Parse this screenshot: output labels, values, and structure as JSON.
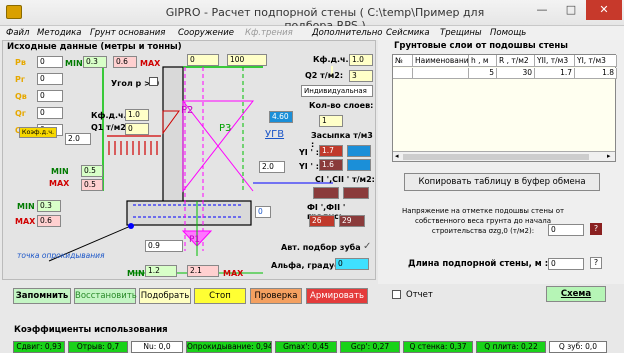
{
  "window": {
    "title": "GIPRO - Расчет подпорной стены ( C:\\temp\\Пример для подбора.RPS )",
    "minimize": "—",
    "maximize": "□",
    "close": "✕"
  },
  "menu": [
    "Файл",
    "Методика",
    "Грунт основания",
    "Сооружение",
    "Кф.трения",
    "Дополнительно",
    "Сейсмика",
    "Трещины",
    "Помощь"
  ],
  "input_header": "Исходные данные (метры и тонны)",
  "left": {
    "labels": {
      "pv": "Рв",
      "pg": "Рг",
      "qv": "Qв",
      "qg": "Qг",
      "qn": "Qп",
      "min": "MIN",
      "max": "MAX",
      "angle": "Угол р > 0",
      "kfdch": "Кф.д.ч.",
      "q1": "Q1 т/м2:",
      "koef": "Коэф.д.ч.",
      "min2": "MIN",
      "max2": "MAX",
      "min3": "MIN",
      "max3": "MAX",
      "min4": "MIN",
      "max4": "MAX",
      "point": "точка опрокидывания",
      "p1": "Р1",
      "p2": "Р2",
      "p3": "Р3",
      "ugv": "УГВ"
    },
    "values": {
      "pv": "0",
      "pg": "0",
      "qv": "0",
      "qg": "0",
      "qn": "0",
      "min1": "0.3",
      "max1": "0.6",
      "top1": "0",
      "top2": "100",
      "kfdch": "1.0",
      "q1": "0",
      "koef": "2.0",
      "v_05a": "0.5",
      "v_05b": "0.5",
      "min3": "0.3",
      "max3": "0.6",
      "w_09": "0.9",
      "min_bot": "1.2",
      "max_bot": "2.1",
      "ugv": "4.60",
      "mid_20": "2.0",
      "blue0": "0"
    }
  },
  "right_canvas": {
    "kfdch_label": "Кф.д.ч.",
    "kfdch": "1.0",
    "q2_label": "Q2 т/м2:",
    "q2": "3",
    "select": "Индивидуальная",
    "layers_label": "Кол-во слоев:",
    "layers": "1",
    "fill_label": "Засыпка т/м3 :",
    "yi1_label": "YI ' :",
    "yi1": "1.7",
    "yi2_label": "YI ' :",
    "yi2": "1.6",
    "ci_label": "CI ',CII ' т/м2:",
    "fi_label": "ФI ',ФII ' градус:",
    "fi1": "26",
    "fi2": "29",
    "auto_label": "Авт. подбор зуба",
    "alpha_label": "Альфа, градус :",
    "alpha": "0"
  },
  "ground": {
    "header": "Грунтовые слои от подошвы стены",
    "columns": [
      "№",
      "Наименование",
      "h , м",
      "R , т/м2",
      "YII, т/м3",
      "YI, т/м3"
    ],
    "rows": [
      [
        "",
        "",
        "5",
        "30",
        "1.7",
        "1.8"
      ]
    ],
    "copy_button": "Копировать таблицу в буфер обмена",
    "stress_label": "Напряжение на отметке подошвы стены от собственного веса грунта до начала строительства σzg,0 (т/м2):",
    "stress_value": "0",
    "help": "?",
    "length_label": "Длина подпорной стены, м :",
    "length_value": "0"
  },
  "buttons": {
    "remember": "Запомнить",
    "restore": "Восстановить",
    "select": "Подобрать",
    "stop": "Стоп",
    "check": "Проверка",
    "reinforce": "Армировать",
    "report": "Отчет",
    "scheme": "Схема"
  },
  "usage": {
    "header": "Коэффициенты использования",
    "cells": [
      {
        "text": "Сдвиг: 0,93",
        "color": "#19d219"
      },
      {
        "text": "Отрыв: 0,7",
        "color": "#19d219"
      },
      {
        "text": "Nu: 0,0",
        "color": "#ffffff"
      },
      {
        "text": "Опрокидывание: 0,94",
        "color": "#19d219"
      },
      {
        "text": "Gmax': 0,45",
        "color": "#19d219"
      },
      {
        "text": "Gcp': 0,27",
        "color": "#19d219"
      },
      {
        "text": "Q стенка: 0,37",
        "color": "#19d219"
      },
      {
        "text": "Q плита: 0,22",
        "color": "#19d219"
      },
      {
        "text": "Q зуб: 0,0",
        "color": "#ffffff"
      }
    ]
  }
}
